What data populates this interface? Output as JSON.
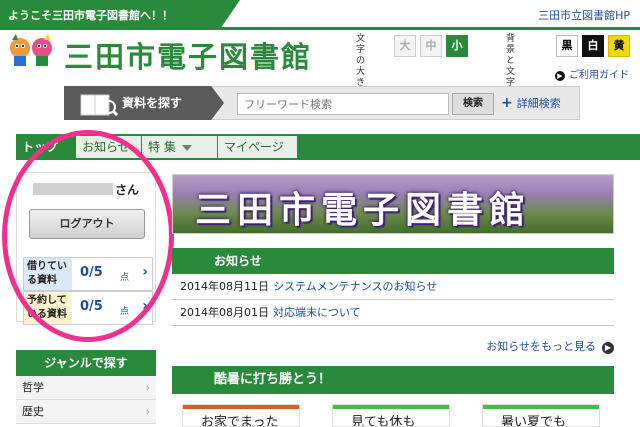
{
  "header": {
    "welcome": "ようこそ三田市電子図書館へ！！",
    "hp_link": "三田市立図書館HP",
    "site_name": "三田市電子図書館",
    "text_size_label_1": "文字の",
    "text_size_label_2": "大きさ",
    "size_large": "大",
    "size_medium": "中",
    "size_small": "小",
    "color_label_1": "背景と",
    "color_label_2": "文字の色",
    "color_black": "黒",
    "color_white": "白",
    "color_yellow": "黄",
    "guide": "ご利用ガイド"
  },
  "search": {
    "tag": "資料を探す",
    "placeholder": "フリーワード検索",
    "button": "検索",
    "advanced": "詳細検索"
  },
  "nav": {
    "items": [
      "トップ",
      "お知らせ",
      "特 集",
      "マイページ"
    ]
  },
  "account": {
    "suffix": "さん",
    "logout": "ログアウト",
    "borrowed_label": "借りている資料",
    "borrowed_count": "0/5",
    "borrowed_unit": "点",
    "reserved_label": "予約している資料",
    "reserved_count": "0/5",
    "reserved_unit": "点"
  },
  "genre": {
    "heading": "ジャンルで探す",
    "items": [
      "哲学",
      "歴史"
    ]
  },
  "banner": {
    "title": "三田市電子図書館"
  },
  "notices": {
    "heading": "お知らせ",
    "items": [
      {
        "date": "2014年08月11日",
        "title": "システムメンテナンスのお知らせ"
      },
      {
        "date": "2014年08月01日",
        "title": "対応端末について"
      }
    ],
    "more": "お知らせをもっと見る"
  },
  "feature": {
    "heading": "酷暑に打ち勝とう！",
    "cards": [
      {
        "text": "お家でまった",
        "color": "#e05a1a"
      },
      {
        "text": "見ても休も",
        "color": "#3cc23c"
      },
      {
        "text": "暑い夏でも",
        "color": "#3cc23c"
      }
    ]
  },
  "colors": {
    "brand_green": "#2a8a3c",
    "link_blue": "#1a4fa0",
    "annotation_pink": "#f0308a"
  }
}
